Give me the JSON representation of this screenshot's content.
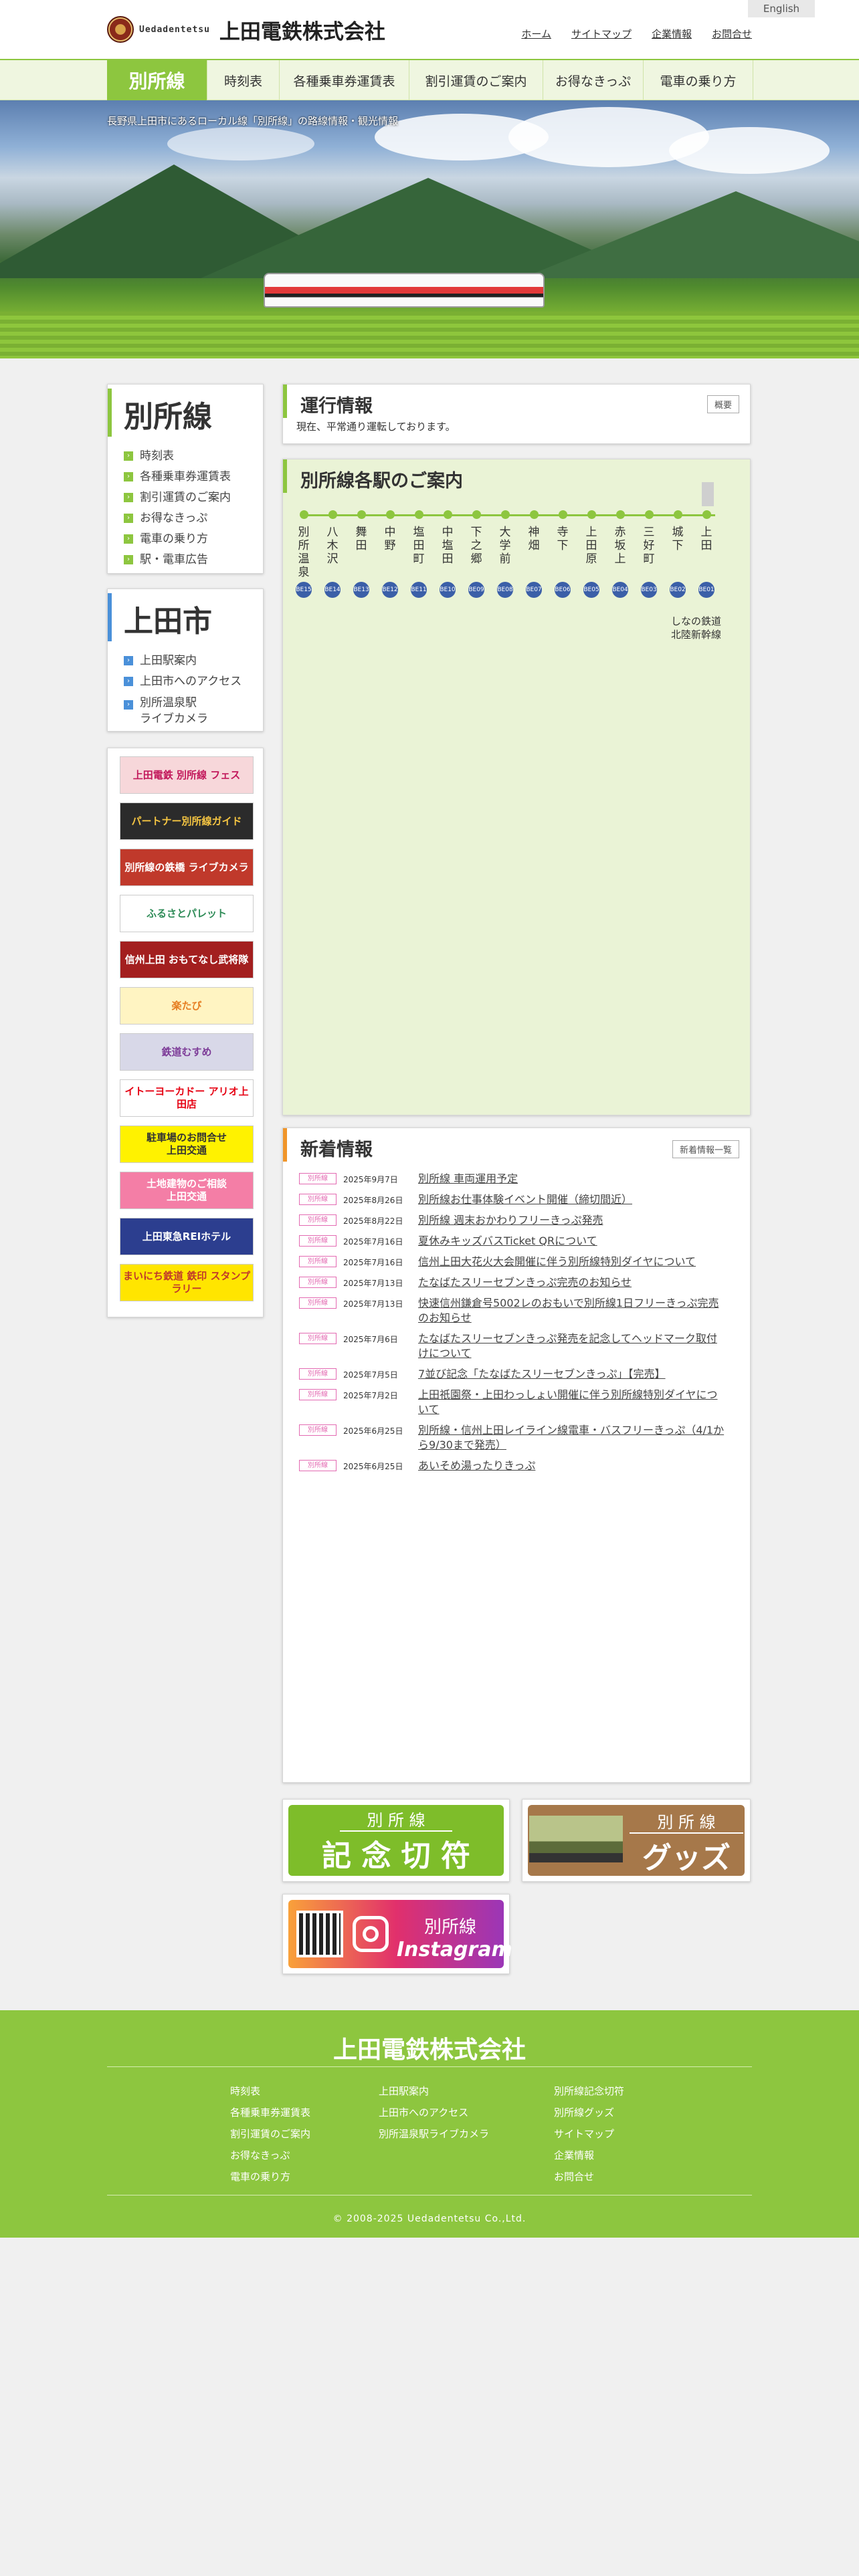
{
  "header": {
    "lang_button": "English",
    "logo_roman": "Uedadentetsu",
    "logo_name": "上田電鉄株式会社",
    "utility_links": [
      "ホーム",
      "サイトマップ",
      "企業情報",
      "お問合せ"
    ]
  },
  "global_nav": {
    "items": [
      "別所線",
      "時刻表",
      "各種乗車券運賃表",
      "割引運賃のご案内",
      "お得なきっぷ",
      "電車の乗り方"
    ]
  },
  "hero": {
    "caption": "長野県上田市にあるローカル線「別所線」の路線情報・観光情報"
  },
  "sidebar": {
    "bessho": {
      "title": "別所線",
      "items": [
        "時刻表",
        "各種乗車券運賃表",
        "割引運賃のご案内",
        "お得なきっぷ",
        "電車の乗り方",
        "駅・電車広告"
      ]
    },
    "ueda": {
      "title": "上田市",
      "items": [
        "上田駅案内",
        "上田市へのアクセス",
        "別所温泉駅\nライブカメラ"
      ]
    },
    "banners": [
      {
        "label": "上田電鉄 別所線 フェス",
        "bg": "#f7d7da",
        "fg": "#c2185b"
      },
      {
        "label": "パートナー別所線ガイド",
        "bg": "#2b2b2b",
        "fg": "#f5c542"
      },
      {
        "label": "別所線の鉄橋 ライブカメラ",
        "bg": "#c0392b",
        "fg": "#ffffff"
      },
      {
        "label": "ふるさとパレット",
        "bg": "#ffffff",
        "fg": "#2e8b57"
      },
      {
        "label": "信州上田 おもてなし武将隊",
        "bg": "#a31f1f",
        "fg": "#ffffff"
      },
      {
        "label": "楽たび",
        "bg": "#fff4c2",
        "fg": "#e67e22"
      },
      {
        "label": "鉄道むすめ",
        "bg": "#d8d8e8",
        "fg": "#7d3c98"
      },
      {
        "label": "イトーヨーカドー アリオ上田店",
        "bg": "#ffffff",
        "fg": "#e60012"
      },
      {
        "label": "駐車場のお問合せ\n上田交通",
        "bg": "#fff200",
        "fg": "#333333"
      },
      {
        "label": "土地建物のご相談\n上田交通",
        "bg": "#f47ea6",
        "fg": "#ffffff"
      },
      {
        "label": "上田東急REIホテル",
        "bg": "#2c3e8f",
        "fg": "#ffffff"
      },
      {
        "label": "まいにち鉄道 鉄印 スタンプラリー",
        "bg": "#ffe500",
        "fg": "#c0392b"
      }
    ]
  },
  "service_info": {
    "title": "運行情報",
    "button": "概要",
    "status": "現在、平常通り運転しております。"
  },
  "stations": {
    "title": "別所線各駅のご案内",
    "list": [
      {
        "name": "別所温泉",
        "no": "BE15"
      },
      {
        "name": "八木沢",
        "no": "BE14"
      },
      {
        "name": "舞田",
        "no": "BE13"
      },
      {
        "name": "中野",
        "no": "BE12"
      },
      {
        "name": "塩田町",
        "no": "BE11"
      },
      {
        "name": "中塩田",
        "no": "BE10"
      },
      {
        "name": "下之郷",
        "no": "BE09"
      },
      {
        "name": "大学前",
        "no": "BE08"
      },
      {
        "name": "神畑",
        "no": "BE07"
      },
      {
        "name": "寺下",
        "no": "BE06"
      },
      {
        "name": "上田原",
        "no": "BE05"
      },
      {
        "name": "赤坂上",
        "no": "BE04"
      },
      {
        "name": "三好町",
        "no": "BE03"
      },
      {
        "name": "城下",
        "no": "BE02"
      },
      {
        "name": "上田",
        "no": "BE01"
      }
    ],
    "transfer_note": "しなの鉄道\n北陸新幹線"
  },
  "news": {
    "title": "新着情報",
    "list_button": "新着情報一覧",
    "items": [
      {
        "tag": "別所線",
        "date": "2025年9月7日",
        "title": "別所線 車両運用予定"
      },
      {
        "tag": "別所線",
        "date": "2025年8月26日",
        "title": "別所線お仕事体験イベント開催（締切間近）"
      },
      {
        "tag": "別所線",
        "date": "2025年8月22日",
        "title": "別所線 週末おかわりフリーきっぷ発売"
      },
      {
        "tag": "別所線",
        "date": "2025年7月16日",
        "title": "夏休みキッズバスTicket QRについて"
      },
      {
        "tag": "別所線",
        "date": "2025年7月16日",
        "title": "信州上田大花火大会開催に伴う別所線特別ダイヤについて"
      },
      {
        "tag": "別所線",
        "date": "2025年7月13日",
        "title": "たなばたスリーセブンきっぷ完売のお知らせ"
      },
      {
        "tag": "別所線",
        "date": "2025年7月13日",
        "title": "快速信州鎌倉号5002レのおもいで別所線1日フリーきっぷ完売のお知らせ"
      },
      {
        "tag": "別所線",
        "date": "2025年7月6日",
        "title": "たなばたスリーセブンきっぷ発売を記念してヘッドマーク取付けについて"
      },
      {
        "tag": "別所線",
        "date": "2025年7月5日",
        "title": "7並び記念「たなばたスリーセブンきっぷ」【完売】"
      },
      {
        "tag": "別所線",
        "date": "2025年7月2日",
        "title": "上田祇園祭・上田わっしょい開催に伴う別所線特別ダイヤについて"
      },
      {
        "tag": "別所線",
        "date": "2025年6月25日",
        "title": "別所線・信州上田レイライン線電車・バスフリーきっぷ（4/1から9/30まで発売）"
      },
      {
        "tag": "別所線",
        "date": "2025年6月25日",
        "title": "あいそめ湯ったりきっぷ"
      }
    ]
  },
  "promos": {
    "commemorative": {
      "top": "別 所 線",
      "main": "記 念 切 符"
    },
    "goods": {
      "top": "別 所 線",
      "main": "グッズ"
    },
    "instagram": {
      "top": "別所線",
      "main": "Instagram"
    }
  },
  "footer": {
    "logo": "上田電鉄株式会社",
    "col1": [
      "時刻表",
      "各種乗車券運賃表",
      "割引運賃のご案内",
      "お得なきっぷ",
      "電車の乗り方"
    ],
    "col2": [
      "上田駅案内",
      "上田市へのアクセス",
      "別所温泉駅ライブカメラ"
    ],
    "col3": [
      "別所線記念切符",
      "別所線グッズ",
      "サイトマップ",
      "企業情報",
      "お問合せ"
    ],
    "copyright": "© 2008-2025 Uedadentetsu Co.,Ltd."
  },
  "colors": {
    "accent_green": "#8dc63f",
    "accent_blue": "#4a90d9",
    "accent_orange": "#f0952a",
    "station_number": "#3b5fa8",
    "news_tag": "#e36ab2"
  }
}
